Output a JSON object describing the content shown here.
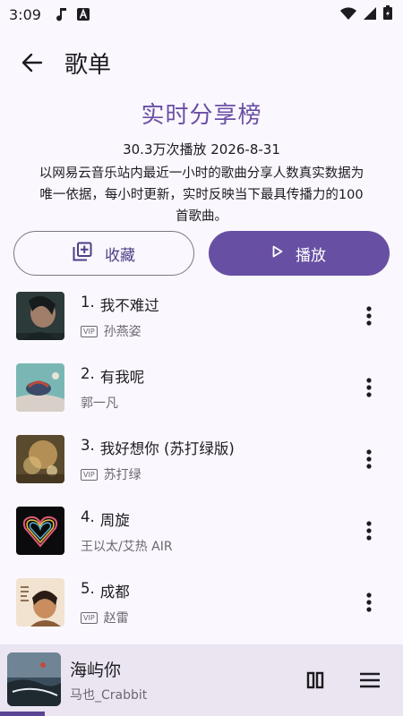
{
  "status_bar": {
    "time": "3:09",
    "left_icons": [
      "music-note-icon",
      "font-a-icon"
    ],
    "right_icons": [
      "wifi-icon",
      "signal-icon",
      "battery-icon"
    ]
  },
  "app_bar": {
    "title": "歌单"
  },
  "playlist": {
    "title": "实时分享榜",
    "meta": "30.3万次播放 2026-8-31",
    "description": "以网易云音乐站内最近一小时的歌曲分享人数真实数据为唯一依据，每小时更新，实时反映当下最具传播力的100首歌曲。"
  },
  "actions": {
    "collect_label": "收藏",
    "play_label": "播放"
  },
  "songs": [
    {
      "index": "1.",
      "title": "我不难过",
      "artist": "孙燕姿",
      "vip": true,
      "vip_label": "VIP"
    },
    {
      "index": "2.",
      "title": "有我呢",
      "artist": "郭一凡",
      "vip": false,
      "vip_label": ""
    },
    {
      "index": "3.",
      "title": "我好想你 (苏打绿版)",
      "artist": "苏打绿",
      "vip": true,
      "vip_label": "VIP"
    },
    {
      "index": "4.",
      "title": "周旋",
      "artist": "王以太/艾热 AIR",
      "vip": false,
      "vip_label": ""
    },
    {
      "index": "5.",
      "title": "成都",
      "artist": "赵雷",
      "vip": true,
      "vip_label": "VIP"
    }
  ],
  "mini_player": {
    "title": "海屿你",
    "artist": "马也_Crabbit",
    "progress": 0.11
  },
  "colors": {
    "accent": "#674fa3",
    "title_purple": "#6a4fa3",
    "background": "#fbf7ff",
    "mini_player_bg": "#ebe5f2"
  }
}
